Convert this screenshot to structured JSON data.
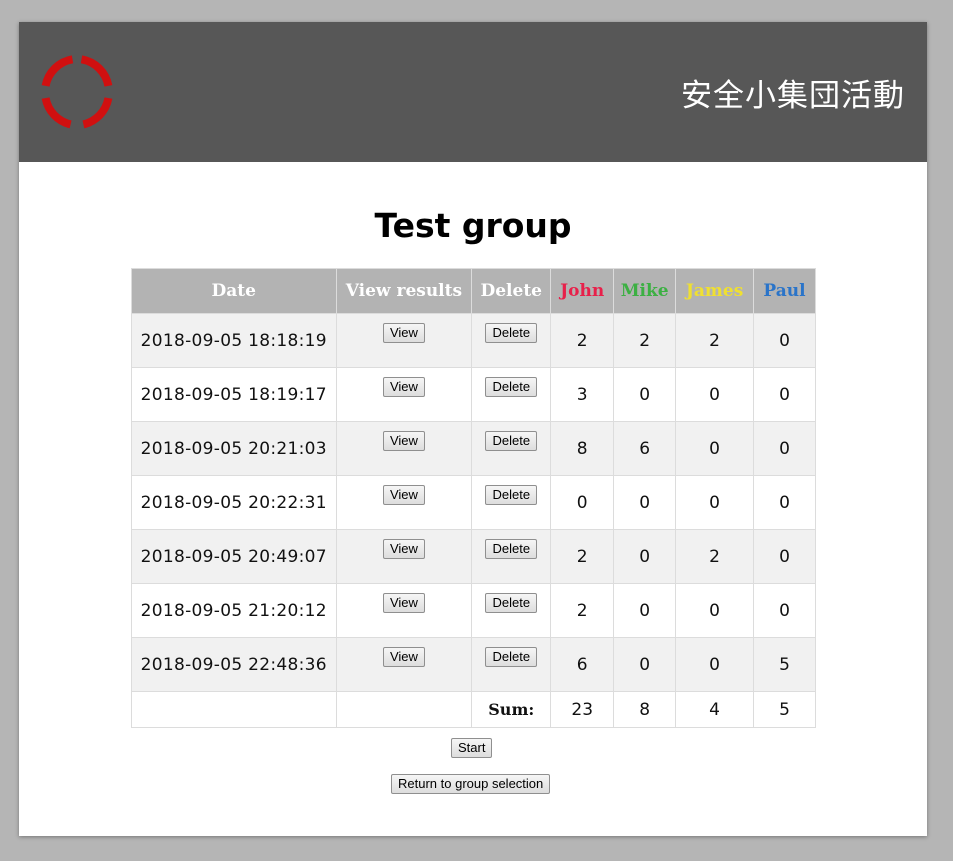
{
  "header": {
    "app_title": "安全小集団活動",
    "logo_icon": "red-ring-logo-icon",
    "logo_color": "#d01010",
    "background": "#575757"
  },
  "group_title": "Test group",
  "table": {
    "columns": {
      "date": "Date",
      "view_results": "View results",
      "delete": "Delete",
      "members": [
        {
          "name": "John",
          "color": "#e8204a"
        },
        {
          "name": "Mike",
          "color": "#3cb043"
        },
        {
          "name": "James",
          "color": "#f0e030"
        },
        {
          "name": "Paul",
          "color": "#2a74c9"
        }
      ]
    },
    "view_label": "View",
    "delete_label": "Delete",
    "rows": [
      {
        "date": "2018-09-05 18:18:19",
        "scores": [
          "2",
          "2",
          "2",
          "0"
        ]
      },
      {
        "date": "2018-09-05 18:19:17",
        "scores": [
          "3",
          "0",
          "0",
          "0"
        ]
      },
      {
        "date": "2018-09-05 20:21:03",
        "scores": [
          "8",
          "6",
          "0",
          "0"
        ]
      },
      {
        "date": "2018-09-05 20:22:31",
        "scores": [
          "0",
          "0",
          "0",
          "0"
        ]
      },
      {
        "date": "2018-09-05 20:49:07",
        "scores": [
          "2",
          "0",
          "2",
          "0"
        ]
      },
      {
        "date": "2018-09-05 21:20:12",
        "scores": [
          "2",
          "0",
          "0",
          "0"
        ]
      },
      {
        "date": "2018-09-05 22:48:36",
        "scores": [
          "6",
          "0",
          "0",
          "5"
        ]
      }
    ],
    "sum_label": "Sum:",
    "sums": [
      "23",
      "8",
      "4",
      "5"
    ]
  },
  "buttons": {
    "start": "Start",
    "return": "Return to group selection"
  }
}
